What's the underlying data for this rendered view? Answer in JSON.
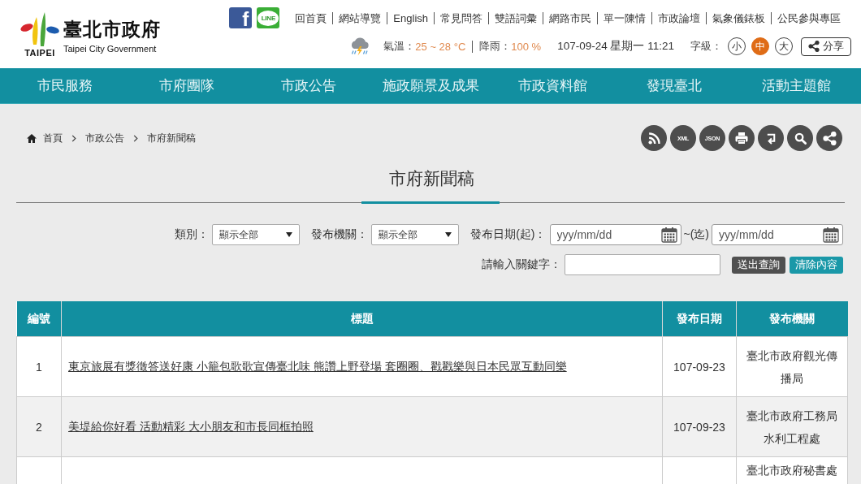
{
  "header": {
    "logo": {
      "emblem_caption": "TAIPEI",
      "name": "臺北市政府",
      "english_name": "Taipei City Government"
    },
    "social": [
      {
        "kind": "facebook",
        "label": "f"
      },
      {
        "kind": "line",
        "label": "LINE"
      }
    ],
    "links": [
      "回首頁",
      "網站導覽",
      "English",
      "常見問答",
      "雙語詞彙",
      "網路市民",
      "單一陳情",
      "市政論壇",
      "氣象儀錶板",
      "公民參與專區"
    ],
    "weather": {
      "temperature_label": "氣溫：",
      "temperature": "25 ~ 28 °C",
      "rain_label": "降雨：",
      "rain": "100 %"
    },
    "datetime": "107-09-24 星期一 11:21",
    "font_size": {
      "label": "字級：",
      "options": [
        {
          "label": "小",
          "selected": false
        },
        {
          "label": "中",
          "selected": true
        },
        {
          "label": "大",
          "selected": false
        }
      ]
    },
    "share": {
      "label": "分享"
    }
  },
  "nav": [
    "市民服務",
    "市府團隊",
    "市政公告",
    "施政願景及成果",
    "市政資料館",
    "發現臺北",
    "活動主題館"
  ],
  "breadcrumb": [
    "首頁",
    "市政公告",
    "市府新聞稿"
  ],
  "tools": [
    {
      "kind": "rss"
    },
    {
      "kind": "xml",
      "label": "XML"
    },
    {
      "kind": "json",
      "label": "JSON"
    },
    {
      "kind": "print"
    },
    {
      "kind": "back"
    },
    {
      "kind": "search"
    },
    {
      "kind": "share"
    }
  ],
  "page_title": "市府新聞稿",
  "filters": {
    "category": {
      "label": "類別：",
      "value": "顯示全部"
    },
    "agency": {
      "label": "發布機關：",
      "value": "顯示全部"
    },
    "date_from": {
      "label": "發布日期(起)：",
      "placeholder": "yyy/mm/dd"
    },
    "date_to": {
      "label": "~(迄)",
      "placeholder": "yyy/mm/dd"
    },
    "keyword": {
      "label": "請輸入關鍵字："
    },
    "buttons": [
      {
        "kind": "submit",
        "label": "送出查詢"
      },
      {
        "kind": "clear",
        "label": "清除內容"
      }
    ]
  },
  "table": {
    "columns": [
      "編號",
      "標題",
      "發布日期",
      "發布機關"
    ],
    "rows": [
      {
        "number": "1",
        "title": "東京旅展有獎徵答送好康 小籠包歌歌宣傳臺北味 熊讚上野登場 套圈圈、戳戳樂與日本民眾互動同樂",
        "date": "107-09-23",
        "agency": "臺北市政府觀光傳播局"
      },
      {
        "number": "2",
        "title": "美堤給你好看 活動精彩 大小朋友和市長同框拍照",
        "date": "107-09-23",
        "agency": "臺北市政府工務局水利工程處"
      },
      {
        "agency": "臺北市政府秘書處"
      }
    ]
  }
}
